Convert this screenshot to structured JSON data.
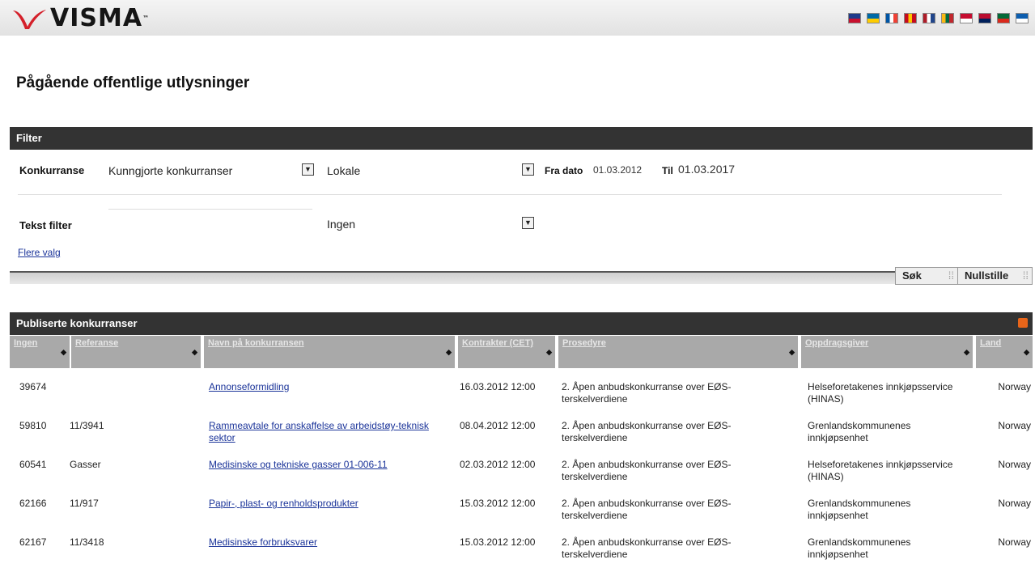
{
  "brand": {
    "name": "VISMA",
    "tm": "™"
  },
  "language_flags": [
    {
      "icon": "uk-flag-icon",
      "colors": [
        "#1f3a8a",
        "#c8102e"
      ]
    },
    {
      "icon": "sweden-flag-icon",
      "colors": [
        "#006aa7",
        "#fecc00"
      ]
    },
    {
      "icon": "france-flag-icon",
      "colors": [
        "#0055a4",
        "#ffffff",
        "#ef4135"
      ]
    },
    {
      "icon": "spain-flag-icon",
      "colors": [
        "#c60b1e",
        "#ffc400",
        "#c60b1e"
      ]
    },
    {
      "icon": "netherlands-flag-icon",
      "colors": [
        "#ae1c28",
        "#ffffff",
        "#21468b"
      ]
    },
    {
      "icon": "lithuania-flag-icon",
      "colors": [
        "#fdb913",
        "#006a44",
        "#c1272d"
      ]
    },
    {
      "icon": "denmark-flag-icon",
      "colors": [
        "#c60c30",
        "#ffffff"
      ]
    },
    {
      "icon": "norway-flag-icon",
      "colors": [
        "#ba0c2f",
        "#00205b"
      ]
    },
    {
      "icon": "portugal-flag-icon",
      "colors": [
        "#046a38",
        "#da291c"
      ]
    },
    {
      "icon": "greece-flag-icon",
      "colors": [
        "#0d5eaf",
        "#ffffff"
      ]
    }
  ],
  "page_title": "Pågående offentlige utlysninger",
  "filter": {
    "header": "Filter",
    "konkurranse_label": "Konkurranse",
    "konkurranse_value": "Kunngjorte konkurranser",
    "scope_value": "Lokale",
    "fra_dato_label": "Fra dato",
    "fra_dato_value": "01.03.2012",
    "til_label": "Til",
    "til_value": "01.03.2017",
    "tekst_filter_label": "Tekst filter",
    "tekst_filter_value": "Ingen",
    "more_options": "Flere valg",
    "search_button": "Søk",
    "reset_button": "Nullstille"
  },
  "results": {
    "header": "Publiserte konkurranser",
    "columns": [
      "Ingen",
      "Referanse",
      "Navn på konkurransen",
      "Kontrakter (CET)",
      "Prosedyre",
      "Oppdragsgiver",
      "Land"
    ],
    "rows": [
      {
        "id": "39674",
        "ref": "",
        "name": "Annonseformidling",
        "date": "16.03.2012 12:00",
        "procedure": "2. Åpen anbudskonkurranse over EØS-terskelverdiene",
        "buyer": "Helseforetakenes innkjøpsservice (HINAS)",
        "country": "Norway"
      },
      {
        "id": "59810",
        "ref": "11/3941",
        "name": "Rammeavtale for anskaffelse av arbeidstøy-teknisk sektor",
        "date": "08.04.2012 12:00",
        "procedure": "2. Åpen anbudskonkurranse over EØS-terskelverdiene",
        "buyer": "Grenlandskommunenes innkjøpsenhet",
        "country": "Norway"
      },
      {
        "id": "60541",
        "ref": "Gasser",
        "name": "Medisinske og tekniske gasser 01-006-11",
        "date": "02.03.2012 12:00",
        "procedure": "2. Åpen anbudskonkurranse over EØS-terskelverdiene",
        "buyer": "Helseforetakenes innkjøpsservice (HINAS)",
        "country": "Norway"
      },
      {
        "id": "62166",
        "ref": "11/917",
        "name": "Papir-, plast- og renholdsprodukter",
        "date": "15.03.2012 12:00",
        "procedure": "2. Åpen anbudskonkurranse over EØS-terskelverdiene",
        "buyer": "Grenlandskommunenes innkjøpsenhet",
        "country": "Norway"
      },
      {
        "id": "62167",
        "ref": "11/3418",
        "name": "Medisinske forbruksvarer",
        "date": "15.03.2012 12:00",
        "procedure": "2. Åpen anbudskonkurranse over EØS-terskelverdiene",
        "buyer": "Grenlandskommunenes innkjøpsenhet",
        "country": "Norway"
      }
    ]
  }
}
